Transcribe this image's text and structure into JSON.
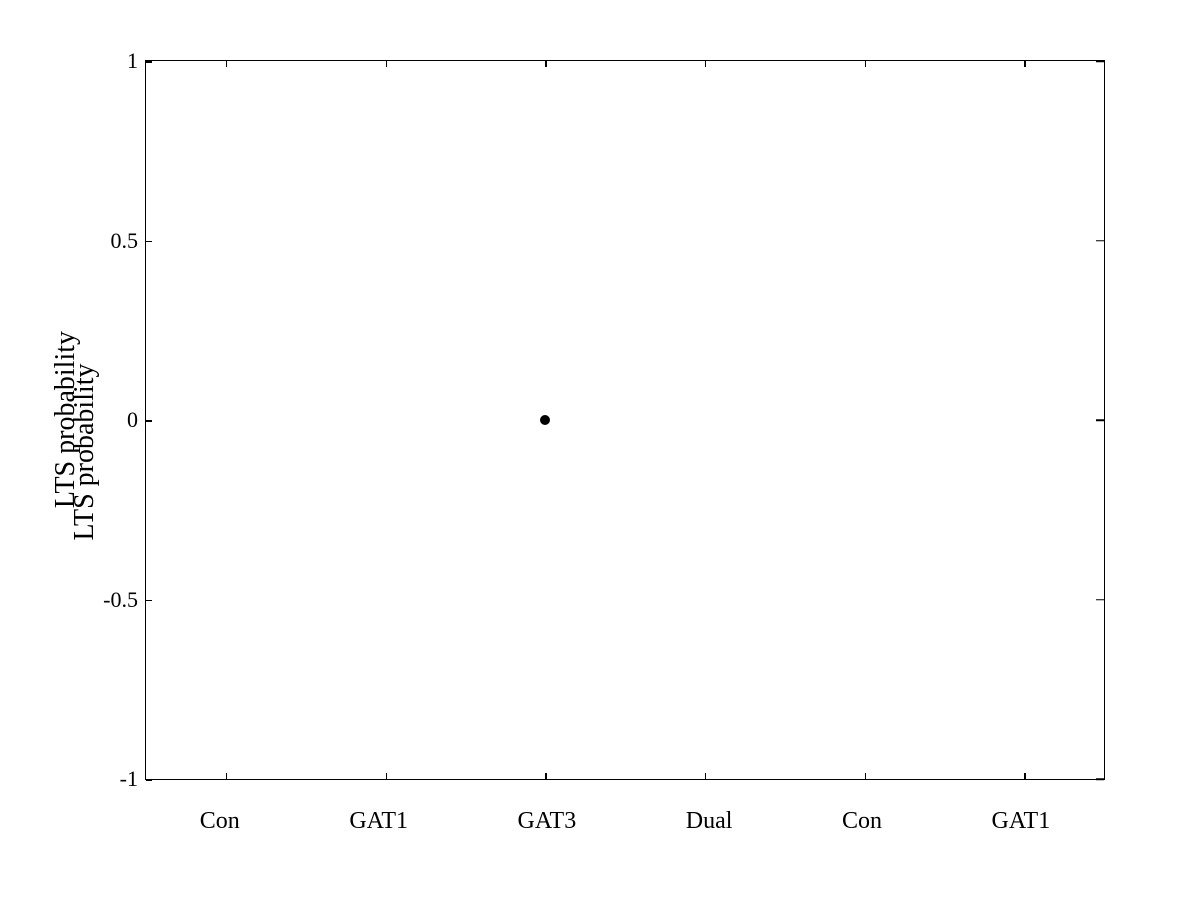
{
  "chart": {
    "title": "",
    "y_axis_label": "LTS probability",
    "x_axis_labels": [
      "Con",
      "GAT1",
      "GAT3",
      "Dual",
      "Con",
      "GAT1"
    ],
    "y_axis": {
      "min": -1,
      "max": 1,
      "ticks": [
        1,
        0.5,
        0,
        -0.5,
        -1
      ]
    },
    "data_points": [
      {
        "x_label": "GAT3",
        "x_index": 2,
        "y_value": 0.0
      }
    ]
  }
}
